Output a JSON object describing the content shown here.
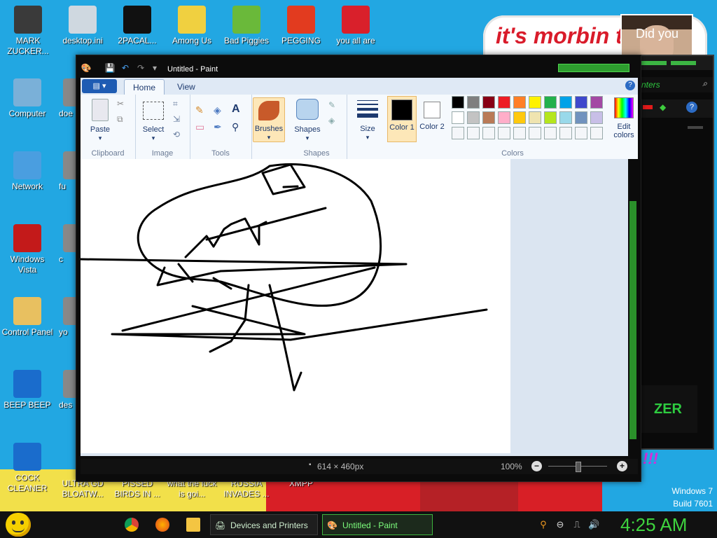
{
  "desktop": {
    "banner_text": "it's morbin t",
    "face_text": "Did you",
    "top_icons": [
      {
        "label": "MARK ZUCKER...",
        "icon": "user-figure-icon",
        "color": "#3a3a3a"
      },
      {
        "label": "desktop.ini",
        "icon": "settings-file-icon",
        "color": "#cfd8e0"
      },
      {
        "label": "2PACAL...",
        "icon": "terminal-icon",
        "color": "#111111"
      },
      {
        "label": "Among Us",
        "icon": "game-folder-icon",
        "color": "#f0d040"
      },
      {
        "label": "Bad Piggies",
        "icon": "pig-icon",
        "color": "#6ab93a"
      },
      {
        "label": "PEGGING",
        "icon": "p-logo-icon",
        "color": "#e23b1f"
      },
      {
        "label": "you all are",
        "icon": "devcpp-icon",
        "color": "#d9202b"
      }
    ],
    "left_icons": [
      {
        "label": "Computer",
        "icon": "computer-icon",
        "color": "#7ab0d8"
      },
      {
        "label": "Network",
        "icon": "network-globe-icon",
        "color": "#4a9ee0"
      },
      {
        "label": "Windows Vista",
        "icon": "recycle-bin-icon",
        "color": "#c31a1a"
      },
      {
        "label": "Control Panel",
        "icon": "control-panel-icon",
        "color": "#e8c060"
      },
      {
        "label": "BEEP BEEP",
        "icon": "blue-file-icon",
        "color": "#1a6ccc"
      },
      {
        "label": "COCK CLEANER",
        "icon": "blue-file-icon",
        "color": "#1a6ccc"
      }
    ],
    "partial_icons": [
      {
        "label": "doe",
        "top": 0
      },
      {
        "label": "fu",
        "top": 0
      },
      {
        "label": "c",
        "top": 0
      },
      {
        "label": "yo",
        "top": 0
      },
      {
        "label": "des",
        "top": 0
      }
    ],
    "bottom_icons": [
      {
        "label": "ULTRA GD BLOATW..."
      },
      {
        "label": "PISSED BIRDS IN ..."
      },
      {
        "label": "what the fuck is goi..."
      },
      {
        "label": "RUSSIA INVADES ..."
      },
      {
        "label": "XMPP"
      }
    ],
    "build_line1": "Windows 7",
    "build_line2": "Build 7601",
    "exclaim": "!!!"
  },
  "razer": {
    "search_label": "nters",
    "logo_text": "ZER"
  },
  "paint": {
    "title": "Untitled - Paint",
    "tabs": [
      "Home",
      "View"
    ],
    "groups": {
      "clipboard": "Clipboard",
      "image": "Image",
      "tools": "Tools",
      "shapes": "Shapes",
      "colors": "Colors"
    },
    "buttons": {
      "paste": "Paste",
      "select": "Select",
      "brushes": "Brushes",
      "shapes": "Shapes",
      "size": "Size",
      "color1": "Color 1",
      "color2": "Color 2",
      "edit_colors": "Edit colors"
    },
    "palette_row1": [
      "#000000",
      "#7f7f7f",
      "#880015",
      "#ed1c24",
      "#ff7f27",
      "#fff200",
      "#22b14c",
      "#00a2e8",
      "#3f48cc",
      "#a349a4"
    ],
    "palette_row2": [
      "#ffffff",
      "#c3c3c3",
      "#b97a57",
      "#ffaec9",
      "#ffc90e",
      "#efe4b0",
      "#b5e61d",
      "#99d9ea",
      "#7092be",
      "#c8bfe7"
    ],
    "color1": "#000000",
    "color2": "#ffffff",
    "status_dims": "614 × 460px",
    "zoom": "100%"
  },
  "taskbar": {
    "items": [
      {
        "label": "Devices and Printers",
        "active": false
      },
      {
        "label": "Untitled - Paint",
        "active": true
      }
    ],
    "clock": "4:25 AM"
  }
}
